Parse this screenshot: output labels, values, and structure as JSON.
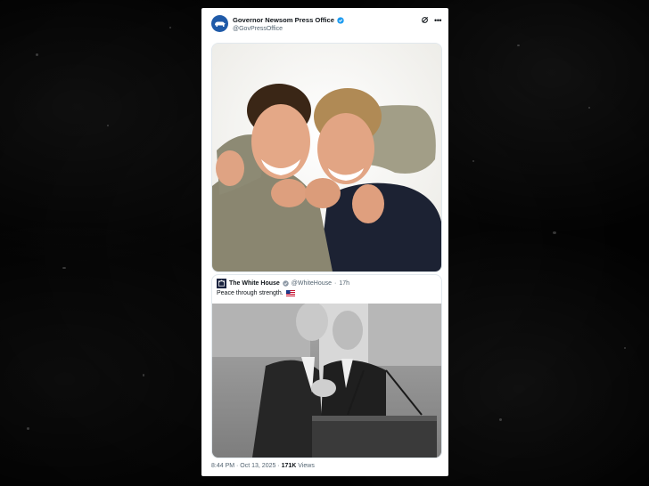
{
  "tweet": {
    "author_name": "Governor Newsom Press Office",
    "author_handle": "@GovPressOffice",
    "timestamp": "8:44 PM · Oct 13, 2025 ·",
    "views_count": "171K",
    "views_label": "Views"
  },
  "quoted": {
    "author_name": "The White House",
    "author_handle": "@WhiteHouse",
    "separator": "·",
    "age": "17h",
    "text": "Peace through strength."
  },
  "colors": {
    "verified": "#1d9bf0",
    "avatar_bg": "#1f5aa8",
    "background": "#070707"
  },
  "icons": [
    "bear-icon",
    "verified-badge-icon",
    "grok-icon",
    "more-options-icon",
    "us-flag-icon",
    "seal-icon"
  ]
}
